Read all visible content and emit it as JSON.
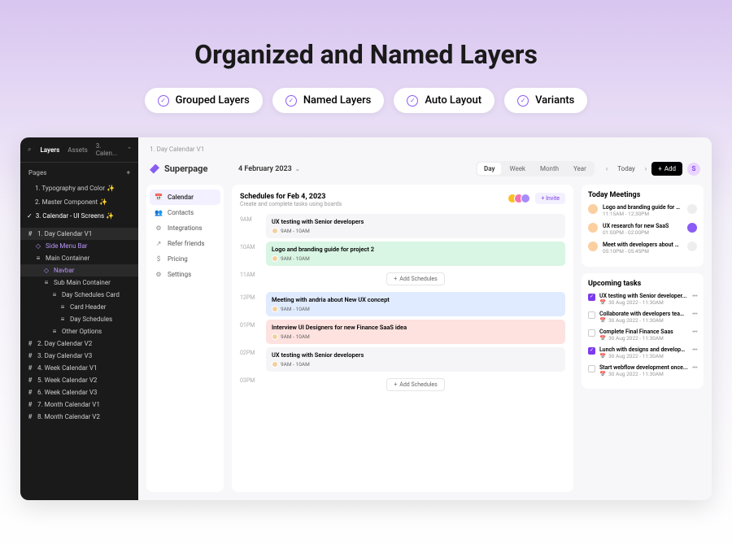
{
  "hero": {
    "title": "Organized and Named Layers",
    "badges": [
      "Grouped Layers",
      "Named Layers",
      "Auto Layout",
      "Variants"
    ]
  },
  "sidebar": {
    "tabs": {
      "layers": "Layers",
      "assets": "Assets",
      "file": "3. Calen..."
    },
    "pages_label": "Pages",
    "pages": [
      "1. Typography and Color ✨",
      "2. Master Component ✨",
      "3. Calendar - UI Screens ✨"
    ],
    "tree": [
      {
        "label": "1. Day Calendar V1",
        "indent": 1,
        "icon": "#",
        "hover": true
      },
      {
        "label": "Side Menu Bar",
        "indent": 2,
        "icon": "◇",
        "purple": true
      },
      {
        "label": "Main Container",
        "indent": 2,
        "icon": "≡"
      },
      {
        "label": "Navbar",
        "indent": 3,
        "icon": "◇",
        "purple": true,
        "hover": true
      },
      {
        "label": "Sub Main Container",
        "indent": 3,
        "icon": "≡"
      },
      {
        "label": "Day Schedules Card",
        "indent": 4,
        "icon": "≡"
      },
      {
        "label": "Card Header",
        "indent": 5,
        "icon": "≡"
      },
      {
        "label": "Day Schedules",
        "indent": 5,
        "icon": "≡"
      },
      {
        "label": "Other Options",
        "indent": 4,
        "icon": "≡"
      },
      {
        "label": "2. Day Calendar V2",
        "indent": 1,
        "icon": "#"
      },
      {
        "label": "3. Day Calendar V3",
        "indent": 1,
        "icon": "#"
      },
      {
        "label": "4. Week Calendar V1",
        "indent": 1,
        "icon": "#"
      },
      {
        "label": "5. Week Calendar V2",
        "indent": 1,
        "icon": "#"
      },
      {
        "label": "6. Week Calendar V3",
        "indent": 1,
        "icon": "#"
      },
      {
        "label": "7. Month Calendar V1",
        "indent": 1,
        "icon": "#"
      },
      {
        "label": "8. Month Calendar V2",
        "indent": 1,
        "icon": "#"
      }
    ]
  },
  "app": {
    "crumb": "1. Day Calendar V1",
    "brand": "Superpage",
    "date": "4 February 2023",
    "view_tabs": [
      "Day",
      "Week",
      "Month",
      "Year"
    ],
    "today": "Today",
    "add": "Add",
    "avatar_letter": "S",
    "nav": [
      {
        "label": "Calendar",
        "icon": "📅",
        "active": true
      },
      {
        "label": "Contacts",
        "icon": "👥"
      },
      {
        "label": "Integrations",
        "icon": "⚙"
      },
      {
        "label": "Refer friends",
        "icon": "↗"
      },
      {
        "label": "Pricing",
        "icon": "$"
      },
      {
        "label": "Settings",
        "icon": "⚙"
      }
    ],
    "schedule": {
      "title": "Schedules for Feb 4, 2023",
      "subtitle": "Create and complete tasks using boards",
      "invite": "+ Invite",
      "add_btn": "Add Schedules",
      "rows": [
        {
          "time": "9AM",
          "title": "UX testing with Senior developers",
          "range": "9AM - 10AM",
          "cls": "ev-gray"
        },
        {
          "time": "10AM",
          "title": "Logo and branding guide for project 2",
          "range": "9AM - 10AM",
          "cls": "ev-green"
        },
        {
          "time": "11AM",
          "add": true
        },
        {
          "time": "12PM",
          "title": "Meeting with andria about New UX concept",
          "range": "9AM - 10AM",
          "cls": "ev-blue"
        },
        {
          "time": "01PM",
          "title": "Interview UI Designers for new Finance SaaS idea",
          "range": "9AM - 10AM",
          "cls": "ev-red"
        },
        {
          "time": "02PM",
          "title": "UX testing with Senior developers",
          "range": "9AM - 10AM",
          "cls": "ev-gray"
        },
        {
          "time": "03PM",
          "add": true
        }
      ]
    },
    "meetings": {
      "title": "Today Meetings",
      "items": [
        {
          "title": "Logo and branding guide for UX...",
          "time": "11:15AM - 12:30PM",
          "color": "#eee"
        },
        {
          "title": "UX research for new SaaS",
          "time": "01:00PM - 02:00PM",
          "color": "#8b5cf6"
        },
        {
          "title": "Meet with developers about UI...",
          "time": "05:10PM - 05:45PM",
          "color": "#eee"
        }
      ]
    },
    "tasks": {
      "title": "Upcoming tasks",
      "items": [
        {
          "title": "UX testing with Senior developer...",
          "time": "30 Aug 2022 - 11:30AM",
          "done": true
        },
        {
          "title": "Collaborate with developers team...",
          "time": "30 Aug 2022 - 11:30AM",
          "done": false
        },
        {
          "title": "Complete Final Finance Saas",
          "time": "30 Aug 2022 - 11:30AM",
          "done": false
        },
        {
          "title": "Lunch with designs and developers",
          "time": "30 Aug 2022 - 11:30AM",
          "done": true
        },
        {
          "title": "Start webflow development once...",
          "time": "30 Aug 2022 - 11:30AM",
          "done": false
        }
      ]
    }
  }
}
